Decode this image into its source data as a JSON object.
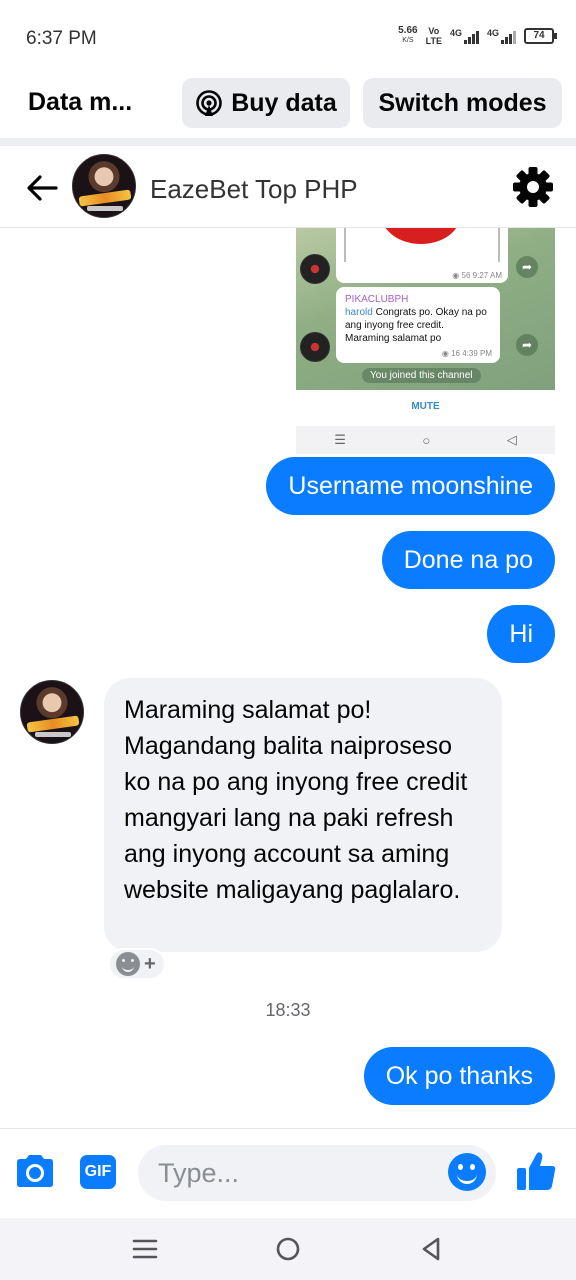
{
  "status_bar": {
    "time": "6:37 PM",
    "speed_value": "5.66",
    "speed_unit": "K/S",
    "volte_top": "Vo",
    "volte_bottom": "LTE",
    "sim1": "4G",
    "sim2": "4G",
    "battery": "74"
  },
  "data_bar": {
    "title": "Data m...",
    "buy_label": "Buy data",
    "switch_label": "Switch modes"
  },
  "header": {
    "contact_name": "EazeBet Top PHP"
  },
  "shared_screenshot": {
    "views_1": "56",
    "time_1": "9:27 AM",
    "channel": "PIKACLUBPH",
    "user": "harold",
    "message": "Congrats po. Okay na po ang inyong free credit. Maraming salamat po",
    "views_2": "16",
    "time_2": "4:39 PM",
    "joined": "You joined this channel",
    "mute": "MUTE"
  },
  "messages": [
    {
      "from": "me",
      "text": "Username moonshine"
    },
    {
      "from": "me",
      "text": "Done na po"
    },
    {
      "from": "me",
      "text": "Hi"
    },
    {
      "from": "them",
      "text": "Maraming salamat po! Magandang balita naiproseso ko na po ang inyong free credit mangyari lang na paki refresh ang inyong account sa aming website maligayang paglalaro."
    },
    {
      "from": "me",
      "text": "Ok po thanks"
    }
  ],
  "timestamp": "18:33",
  "reaction_plus": "+",
  "composer": {
    "gif_label": "GIF",
    "placeholder": "Type..."
  },
  "colors": {
    "accent": "#0a7cff",
    "incoming_bubble": "#f0f2f5"
  }
}
